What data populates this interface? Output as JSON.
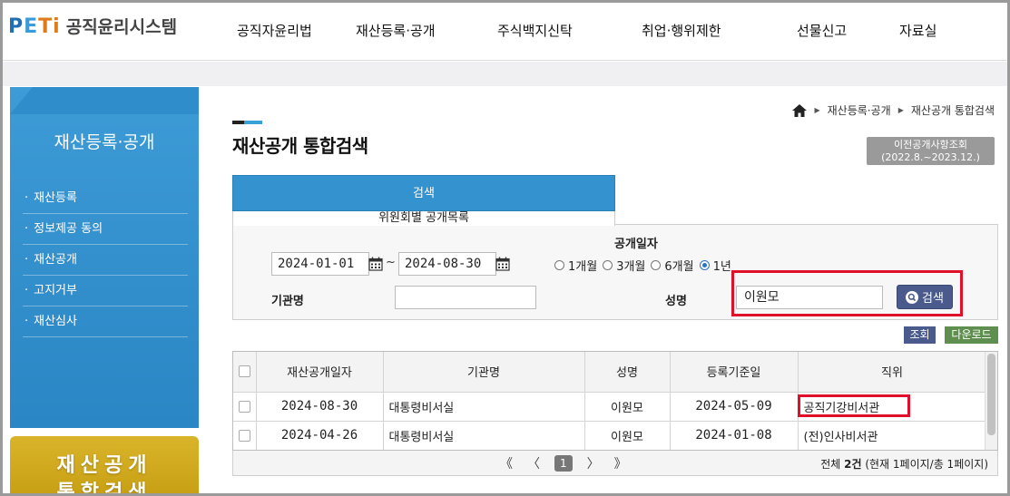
{
  "header": {
    "logo_brand": "PETi",
    "logo_text": "공직윤리시스템",
    "nav": [
      "공직자윤리법",
      "재산등록·공개",
      "주식백지신탁",
      "취업·행위제한",
      "선물신고",
      "자료실"
    ]
  },
  "sidebar": {
    "title": "재산등록·공개",
    "items": [
      {
        "label": "재산등록"
      },
      {
        "label": "정보제공 동의"
      },
      {
        "label": "재산공개"
      },
      {
        "label": "고지거부"
      },
      {
        "label": "재산심사"
      }
    ],
    "banner_line1": "재산공개",
    "banner_line2": "통합검색"
  },
  "breadcrumb": [
    "재산등록·공개",
    "재산공개 통합검색"
  ],
  "page_title": "재산공개 통합검색",
  "prev_button": {
    "line1": "이전공개사항조회",
    "line2": "(2022.8.~2023.12.)"
  },
  "tabs": {
    "search": "검색",
    "committee": "위원회별 공개목록"
  },
  "search": {
    "date_label": "공개일자",
    "date_from": "2024-01-01",
    "date_to": "2024-08-30",
    "tilde": "~",
    "range_options": [
      {
        "label": "1개월",
        "selected": false
      },
      {
        "label": "3개월",
        "selected": false
      },
      {
        "label": "6개월",
        "selected": false
      },
      {
        "label": "1년",
        "selected": true
      }
    ],
    "org_label": "기관명",
    "org_value": "",
    "name_label": "성명",
    "name_value": "이원모",
    "search_button": "검색"
  },
  "actions": {
    "view": "조회",
    "download": "다운로드"
  },
  "table": {
    "columns": [
      "재산공개일자",
      "기관명",
      "성명",
      "등록기준일",
      "직위"
    ],
    "rows": [
      {
        "date": "2024-08-30",
        "org": "대통령비서실",
        "name": "이원모",
        "reg_date": "2024-05-09",
        "position": "공직기강비서관"
      },
      {
        "date": "2024-04-26",
        "org": "대통령비서실",
        "name": "이원모",
        "reg_date": "2024-01-08",
        "position": "(전)인사비서관"
      }
    ]
  },
  "pager": {
    "first": "《",
    "prev": "〈",
    "current": "1",
    "next": "〉",
    "last": "》",
    "total_prefix": "전체 ",
    "total_count": "2건",
    "total_suffix": " (현재 1페이지/총 1페이지)"
  },
  "colors": {
    "primary_blue": "#3492ce",
    "highlight_red": "#e0102a",
    "button_navy": "#4a5a8c",
    "download_green": "#5f8f4e",
    "banner_gold": "#d9b42a"
  }
}
